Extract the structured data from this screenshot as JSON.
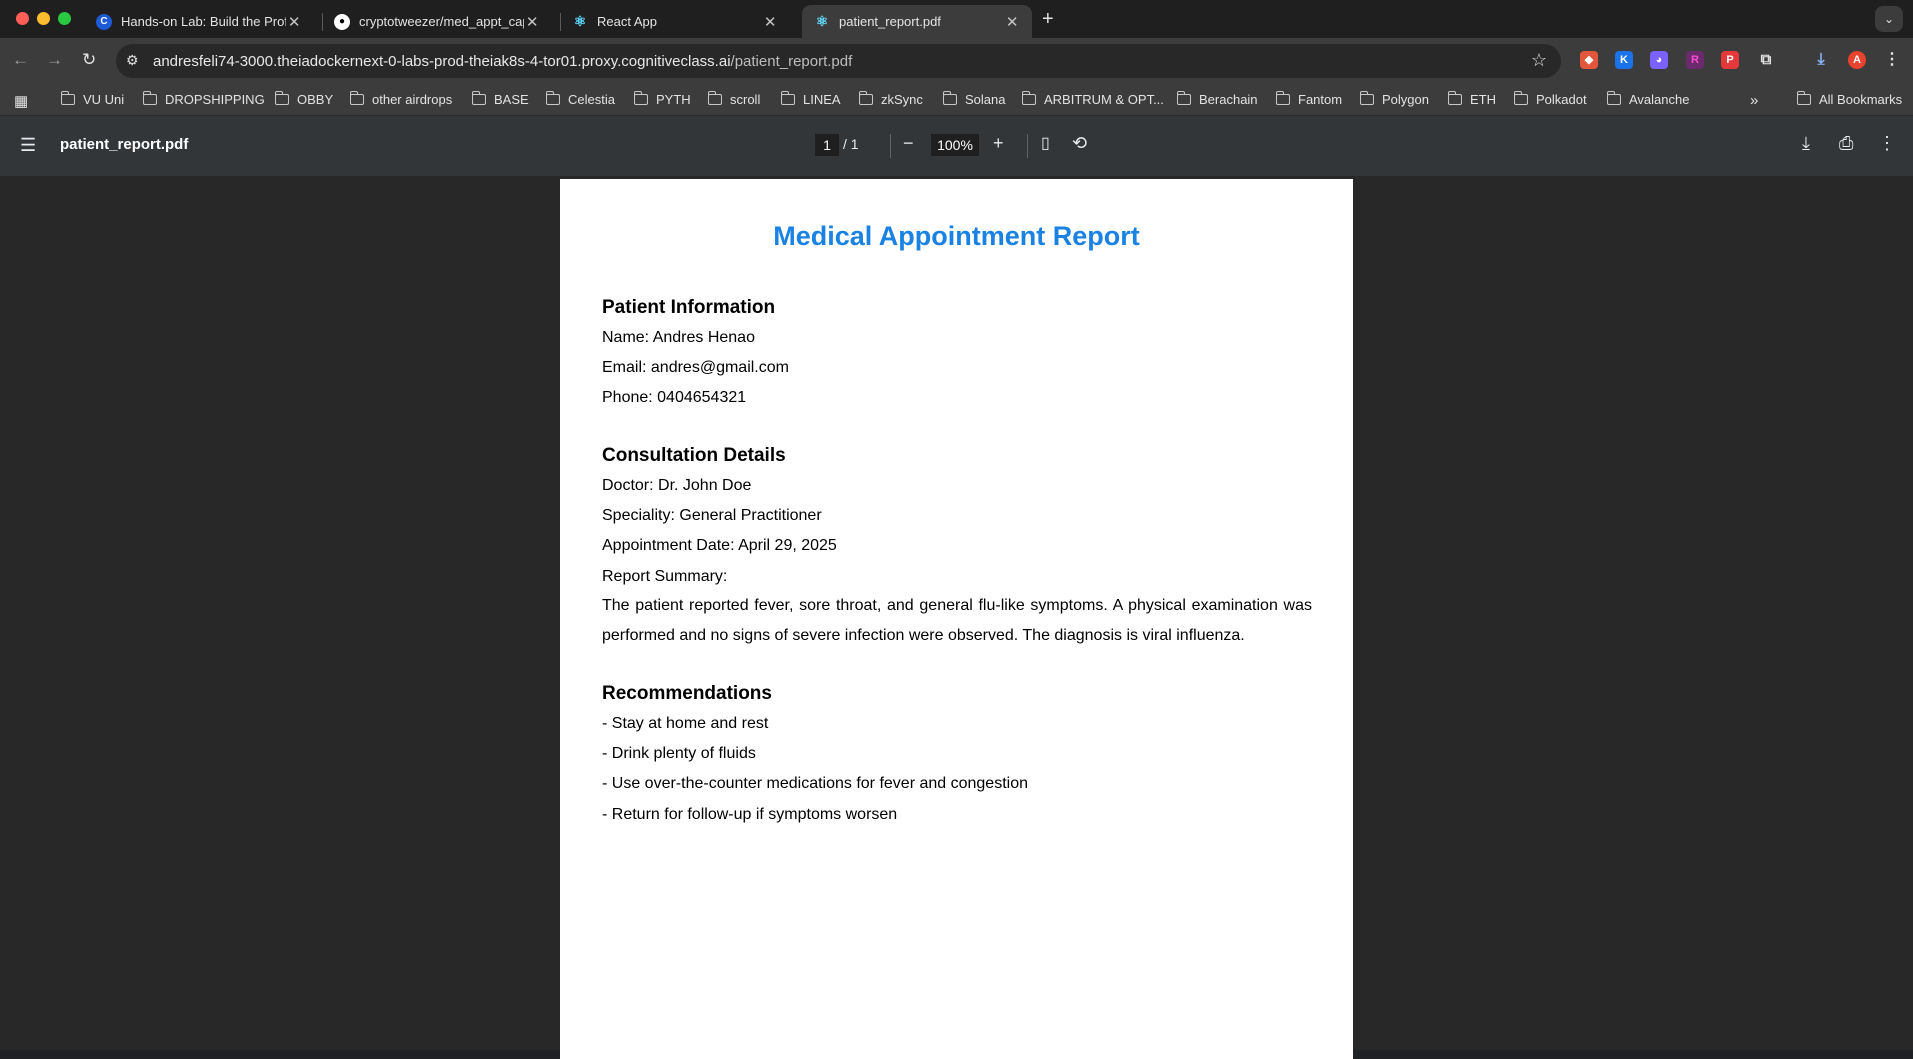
{
  "tabs": [
    {
      "title": "Hands-on Lab: Build the Profi",
      "favicon": "C"
    },
    {
      "title": "cryptotweezer/med_appt_cap",
      "favicon": "github-icon"
    },
    {
      "title": "React App",
      "favicon": "react-icon"
    },
    {
      "title": "patient_report.pdf",
      "favicon": "react-icon",
      "active": true
    }
  ],
  "address": {
    "host": "andresfeli74-3000.theiadockernext-0-labs-prod-theiak8s-4-tor01.proxy.cognitiveclass.ai",
    "path": "/patient_report.pdf"
  },
  "bookmarks": [
    "VU Uni",
    "DROPSHIPPING",
    "OBBY",
    "other airdrops",
    "BASE",
    "Celestia",
    "PYTH",
    "scroll",
    "LINEA",
    "zkSync",
    "Solana",
    "ARBITRUM & OPT...",
    "Berachain",
    "Fantom",
    "Polygon",
    "ETH",
    "Polkadot",
    "Avalanche"
  ],
  "bookmarks_overflow": "»",
  "all_bookmarks": "All Bookmarks",
  "profile_initial": "A",
  "pdf": {
    "filename": "patient_report.pdf",
    "page_current": "1",
    "page_total": "/  1",
    "zoom": "100%"
  },
  "report": {
    "title": "Medical Appointment Report",
    "patient_heading": "Patient Information",
    "name": "Name: Andres Henao",
    "email": "Email: andres@gmail.com",
    "phone": "Phone: 0404654321",
    "consult_heading": "Consultation Details",
    "doctor": "Doctor: Dr. John Doe",
    "speciality": "Speciality: General Practitioner",
    "date": "Appointment Date: April 29, 2025",
    "summary_label": "Report Summary:",
    "summary": "The patient reported fever, sore throat, and general flu-like symptoms. A physical examination was performed and no signs of severe infection were observed. The diagnosis is viral influenza.",
    "rec_heading": "Recommendations",
    "rec1": "- Stay at home and rest",
    "rec2": "- Drink plenty of fluids",
    "rec3": "- Use over-the-counter medications for fever and congestion",
    "rec4": "- Return for follow-up if symptoms worsen"
  },
  "colors": {
    "report_title": "#1a82e2",
    "toolbar": "#3c3c3c",
    "pdf_toolbar": "#323639"
  }
}
